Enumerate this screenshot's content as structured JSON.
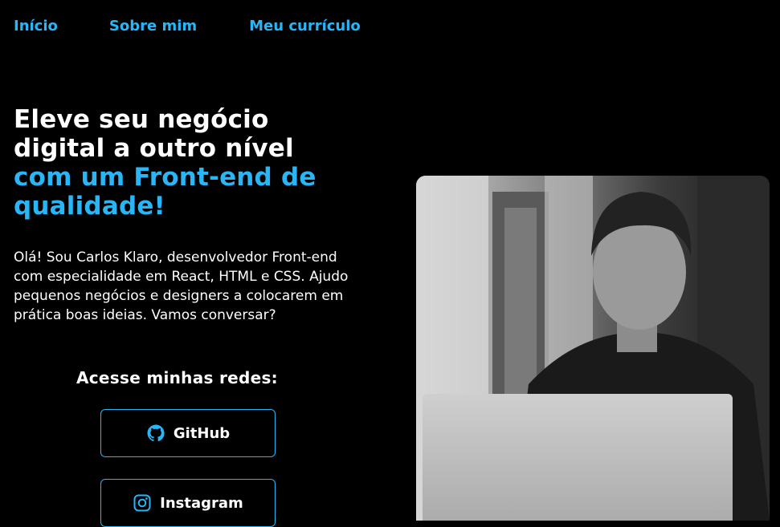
{
  "nav": {
    "items": [
      {
        "label": "Início"
      },
      {
        "label": "Sobre mim"
      },
      {
        "label": "Meu currículo"
      }
    ]
  },
  "hero": {
    "headline_white_1": "Eleve seu negócio",
    "headline_white_2": "digital a outro nível",
    "headline_blue_1": "com um Front-end de",
    "headline_blue_2": "qualidade!",
    "intro": "Olá! Sou Carlos Klaro, desenvolvedor Front-end com especialidade em React, HTML e CSS. Ajudo pequenos negócios e designers a colocarem em prática boas ideias. Vamos conversar?"
  },
  "social": {
    "title": "Acesse minhas redes:",
    "buttons": [
      {
        "label": "GitHub",
        "icon": "github-icon"
      },
      {
        "label": "Instagram",
        "icon": "instagram-icon"
      }
    ]
  },
  "colors": {
    "accent": "#29b6f6",
    "background": "#000000",
    "text": "#ffffff"
  }
}
